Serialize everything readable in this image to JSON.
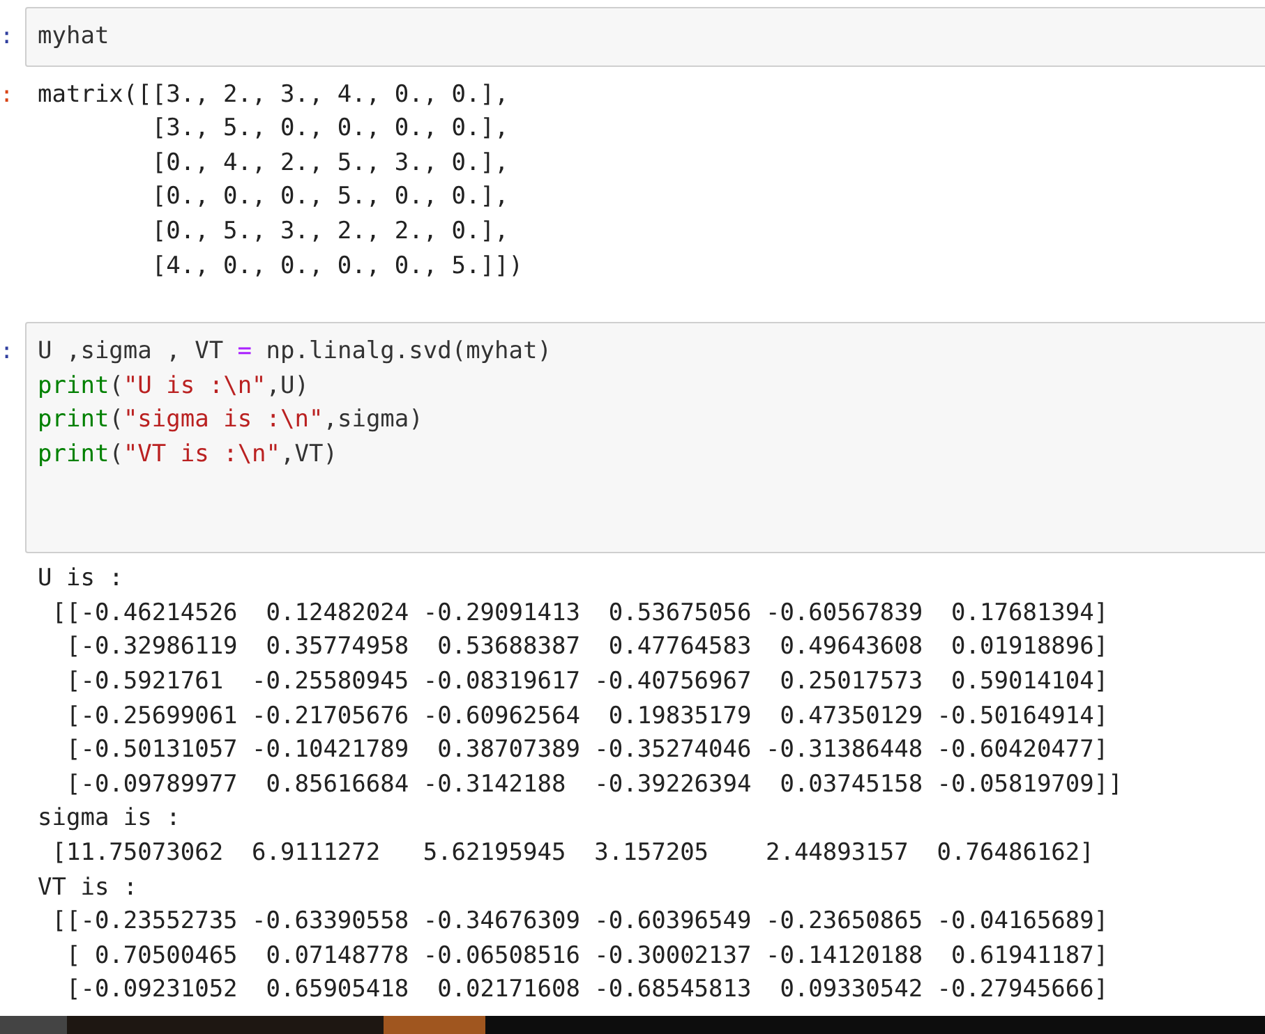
{
  "cells": [
    {
      "kind": "input",
      "prompt": ":",
      "code_lines": [
        [
          {
            "kind": "plain",
            "text": "myhat"
          }
        ]
      ]
    },
    {
      "kind": "output",
      "prompt": ":",
      "lines": [
        "matrix([[3., 2., 3., 4., 0., 0.],",
        "        [3., 5., 0., 0., 0., 0.],",
        "        [0., 4., 2., 5., 3., 0.],",
        "        [0., 0., 0., 5., 0., 0.],",
        "        [0., 5., 3., 2., 2., 0.],",
        "        [4., 0., 0., 0., 0., 5.]])"
      ]
    },
    {
      "kind": "input",
      "prompt": ":",
      "code_lines": [
        [
          {
            "kind": "plain",
            "text": "U ,sigma , VT "
          },
          {
            "kind": "operator",
            "text": "="
          },
          {
            "kind": "plain",
            "text": " np.linalg.svd(myhat)"
          }
        ],
        [
          {
            "kind": "builtin",
            "text": "print"
          },
          {
            "kind": "plain",
            "text": "("
          },
          {
            "kind": "string",
            "text": "\"U is :\\n\""
          },
          {
            "kind": "plain",
            "text": ",U)"
          }
        ],
        [
          {
            "kind": "builtin",
            "text": "print"
          },
          {
            "kind": "plain",
            "text": "("
          },
          {
            "kind": "string",
            "text": "\"sigma is :\\n\""
          },
          {
            "kind": "plain",
            "text": ",sigma)"
          }
        ],
        [
          {
            "kind": "builtin",
            "text": "print"
          },
          {
            "kind": "plain",
            "text": "("
          },
          {
            "kind": "string",
            "text": "\"VT is :\\n\""
          },
          {
            "kind": "plain",
            "text": ",VT)"
          }
        ]
      ]
    },
    {
      "kind": "output",
      "lines": [
        "U is :",
        " [[-0.46214526  0.12482024 -0.29091413  0.53675056 -0.60567839  0.17681394]",
        "  [-0.32986119  0.35774958  0.53688387  0.47764583  0.49643608  0.01918896]",
        "  [-0.5921761  -0.25580945 -0.08319617 -0.40756967  0.25017573  0.59014104]",
        "  [-0.25699061 -0.21705676 -0.60962564  0.19835179  0.47350129 -0.50164914]",
        "  [-0.50131057 -0.10421789  0.38707389 -0.35274046 -0.31386448 -0.60420477]",
        "  [-0.09789977  0.85616684 -0.3142188  -0.39226394  0.03745158 -0.05819709]]",
        "sigma is :",
        " [11.75073062  6.9111272   5.62195945  3.157205    2.44893157  0.76486162]",
        "VT is :",
        " [[-0.23552735 -0.63390558 -0.34676309 -0.60396549 -0.23650865 -0.04165689]",
        "  [ 0.70500465  0.07148778 -0.06508516 -0.30002137 -0.14120188  0.61941187]",
        "  [-0.09231052  0.65905418  0.02171608 -0.68545813  0.09330542 -0.27945666]"
      ]
    }
  ]
}
